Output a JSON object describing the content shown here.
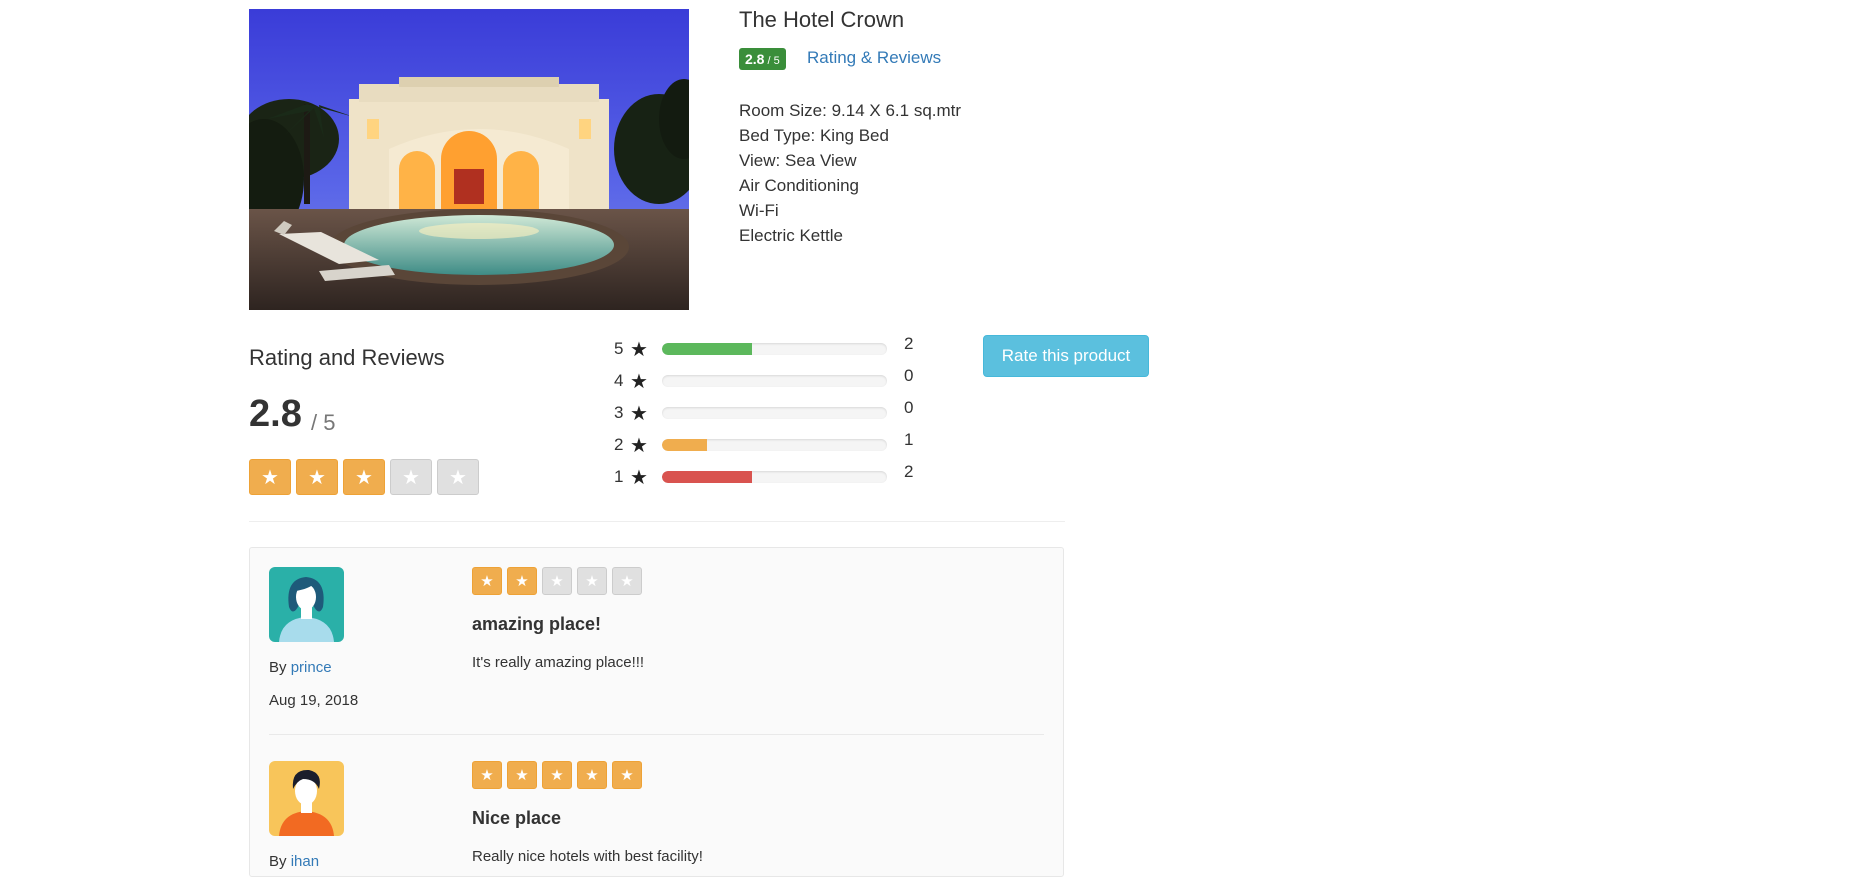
{
  "hotel": {
    "name": "The Hotel Crown",
    "rating_value": "2.8",
    "rating_suffix": " / 5",
    "rating_link": "Rating & Reviews",
    "features": [
      "Room Size: 9.14 X 6.1 sq.mtr",
      "Bed Type: King Bed",
      "View: Sea View",
      "Air Conditioning",
      "Wi-Fi",
      "Electric Kettle"
    ]
  },
  "summary": {
    "heading": "Rating and Reviews",
    "score": "2.8",
    "out_of": "/ 5",
    "stars_filled": 3,
    "stars_total": 5,
    "star_glyph": "★",
    "colors": {
      "star_on": "#f0ad4e",
      "star_off": "#e0e0e0"
    }
  },
  "breakdown": [
    {
      "stars": "5",
      "count": "2",
      "fraction": 0.4,
      "color": "#5cb85c"
    },
    {
      "stars": "4",
      "count": "0",
      "fraction": 0,
      "color": "#5cb85c"
    },
    {
      "stars": "3",
      "count": "0",
      "fraction": 0,
      "color": "#5bc0de"
    },
    {
      "stars": "2",
      "count": "1",
      "fraction": 0.2,
      "color": "#f0ad4e"
    },
    {
      "stars": "1",
      "count": "2",
      "fraction": 0.4,
      "color": "#d9534f"
    }
  ],
  "rate_button": "Rate this product",
  "reviews": [
    {
      "by_label": "By ",
      "author": "prince",
      "date": "Aug 19, 2018",
      "stars_filled": 2,
      "title": "amazing place!",
      "text": "It's really amazing place!!!",
      "avatar_icon": "female-avatar-icon"
    },
    {
      "by_label": "By ",
      "author": "ihan",
      "date": "",
      "stars_filled": 5,
      "title": "Nice place",
      "text": "Really nice hotels with best facility!",
      "avatar_icon": "male-avatar-icon"
    }
  ]
}
